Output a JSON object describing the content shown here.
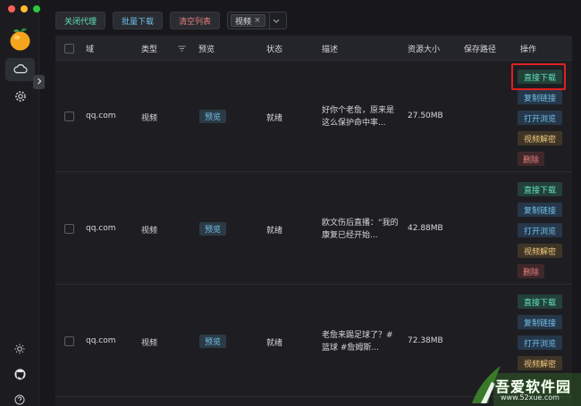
{
  "toolbar": {
    "close_proxy": "关闭代理",
    "batch_download": "批量下载",
    "clear_list": "清空列表",
    "filter_tag": "视频",
    "filter_tag_close": "×"
  },
  "table": {
    "headers": {
      "domain": "域",
      "type": "类型",
      "preview": "预览",
      "status": "状态",
      "description": "描述",
      "size": "资源大小",
      "save_path": "保存路径",
      "actions": "操作"
    },
    "rows": [
      {
        "domain": "qq.com",
        "type": "视频",
        "preview": "预览",
        "status": "就绪",
        "description": "好你个老詹，原来是这么保护命中率...",
        "size": "27.50MB"
      },
      {
        "domain": "qq.com",
        "type": "视频",
        "preview": "预览",
        "status": "就绪",
        "description": "欧文伤后直播：“我的康复已经开始...",
        "size": "42.88MB"
      },
      {
        "domain": "qq.com",
        "type": "视频",
        "preview": "预览",
        "status": "就绪",
        "description": "老詹来踢足球了？#篮球 #詹姆斯...",
        "size": "72.38MB"
      }
    ],
    "actions": {
      "direct_download": "直接下载",
      "copy_link": "复制链接",
      "open_browser": "打开浏览",
      "decrypt_video": "视频解密",
      "delete": "删除"
    }
  },
  "watermark": {
    "text": "吾爱软件园",
    "url": "www.52xue.com"
  },
  "colors": {
    "accent_green": "#63e2b7",
    "accent_blue": "#70c0e8",
    "accent_red": "#e88080",
    "accent_orange": "#f2c97d",
    "highlight_box": "#e02020"
  },
  "icons": {
    "app_logo": "orange-logo-icon",
    "nav_cloud": "cloud-icon",
    "nav_settings": "gear-icon",
    "sidebar_toggle": "chevron-right-icon",
    "theme": "sun-icon",
    "github": "github-icon",
    "help": "help-icon",
    "filter_dropdown": "chevron-down-icon",
    "column_filter": "filter-icon"
  }
}
